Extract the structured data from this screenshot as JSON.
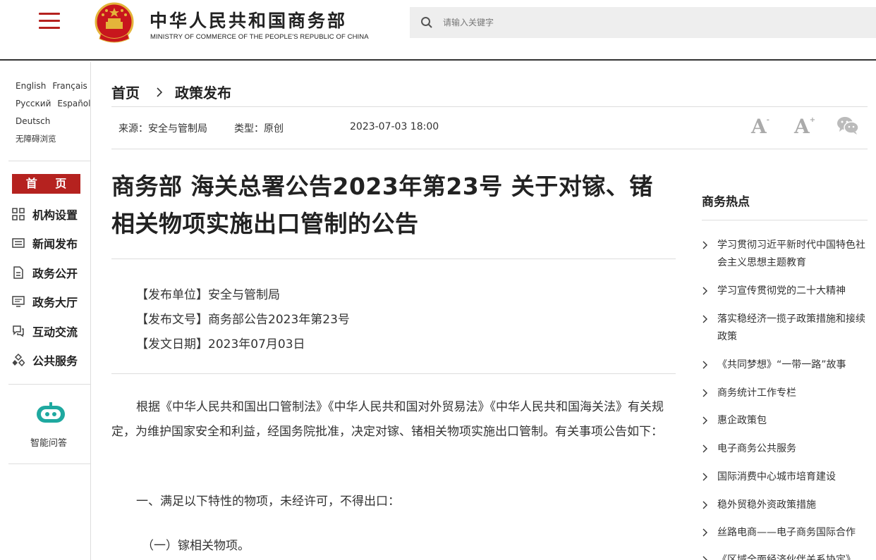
{
  "header": {
    "title": "中华人民共和国商务部",
    "subtitle": "MINISTRY OF COMMERCE OF THE PEOPLE'S REPUBLIC OF CHINA",
    "search_placeholder": "请输入关键字",
    "accent_color": "#b5221f"
  },
  "sidebar": {
    "languages": [
      "English",
      "Français",
      "Русский",
      "Español",
      "Deutsch",
      "无障碍浏览"
    ],
    "home": "首 页",
    "items": [
      {
        "label": "机构设置",
        "icon": "org-grid-icon"
      },
      {
        "label": "新闻发布",
        "icon": "news-list-icon"
      },
      {
        "label": "政务公开",
        "icon": "document-icon"
      },
      {
        "label": "政务大厅",
        "icon": "monitor-icon"
      },
      {
        "label": "互动交流",
        "icon": "chat-icon"
      },
      {
        "label": "公共服务",
        "icon": "service-network-icon"
      }
    ],
    "assistant_label": "智能问答"
  },
  "breadcrumb": {
    "home": "首页",
    "current": "政策发布"
  },
  "meta": {
    "source": "来源：安全与管制局",
    "type": "类型：原创",
    "date": "2023-07-03 18:00"
  },
  "tools": {
    "font_smaller": "A",
    "font_smaller_sign": "-",
    "font_larger": "A",
    "font_larger_sign": "+"
  },
  "article": {
    "title": "商务部 海关总署公告2023年第23号 关于对镓、锗相关物项实施出口管制的公告",
    "publisher": "【发布单位】安全与管制局",
    "doc_no": "【发布文号】商务部公告2023年第23号",
    "doc_date": "【发文日期】2023年07月03日",
    "para1": "根据《中华人民共和国出口管制法》《中华人民共和国对外贸易法》《中华人民共和国海关法》有关规定，为维护国家安全和利益，经国务院批准，决定对镓、锗相关物项实施出口管制。有关事项公告如下：",
    "para2": "一、满足以下特性的物项，未经许可，不得出口：",
    "para3": "（一）镓相关物项。"
  },
  "hot": {
    "title": "商务热点",
    "items": [
      "学习贯彻习近平新时代中国特色社会主义思想主题教育",
      "学习宣传贯彻党的二十大精神",
      "落实稳经济一揽子政策措施和接续政策",
      "《共同梦想》“一带一路”故事",
      "商务统计工作专栏",
      "惠企政策包",
      "电子商务公共服务",
      "国际消费中心城市培育建设",
      "稳外贸稳外资政策措施",
      "丝路电商——电子商务国际合作",
      "《区域全面经济伙伴关系协定》"
    ]
  }
}
